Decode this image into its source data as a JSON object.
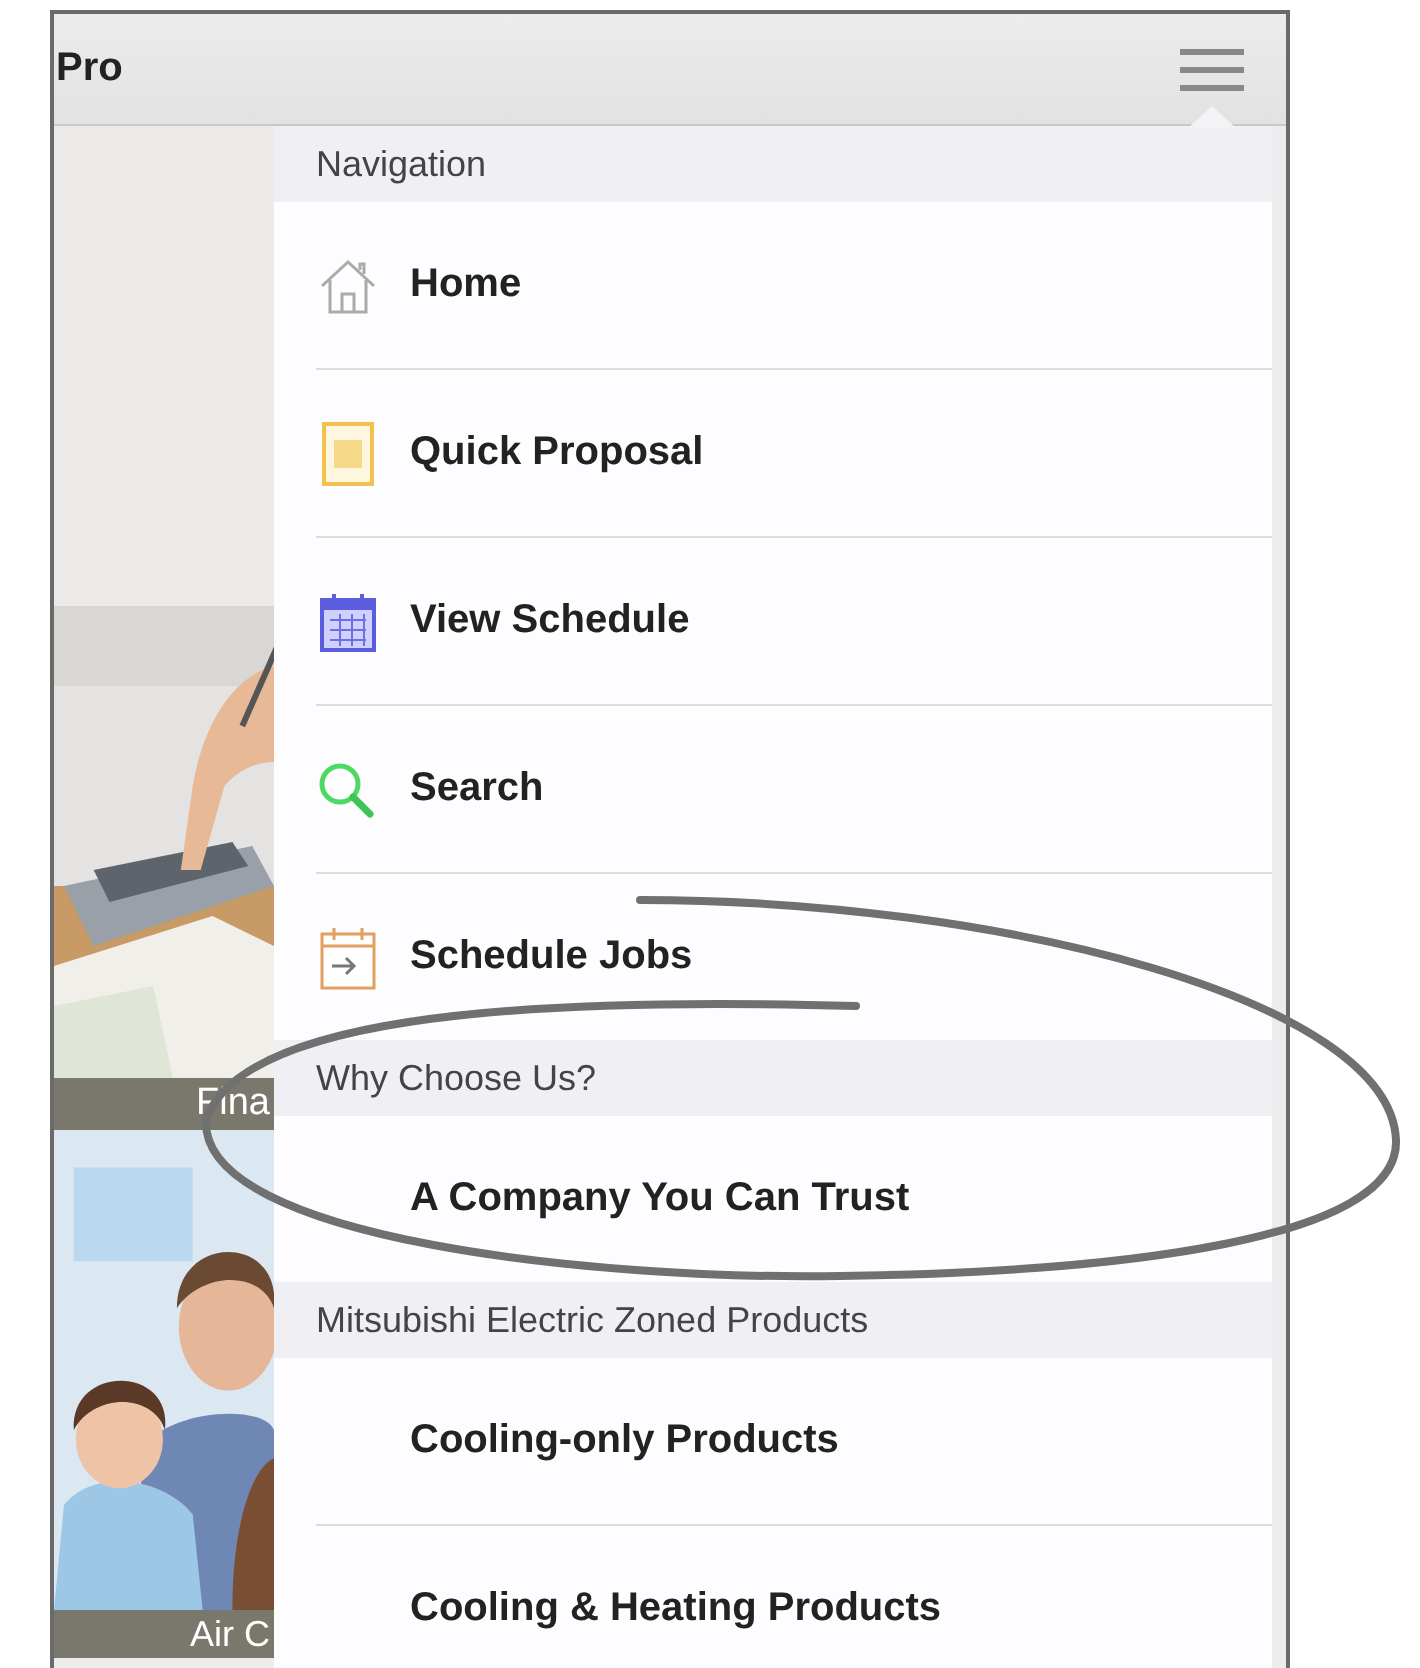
{
  "header": {
    "title": "Pro"
  },
  "tiles": [
    {
      "kind": "picture",
      "caption": "Fina"
    },
    {
      "kind": "picture",
      "caption": "Air C"
    }
  ],
  "menu": {
    "sections": [
      {
        "title": "Navigation",
        "items": [
          {
            "label": "Home"
          },
          {
            "label": "Quick Proposal"
          },
          {
            "label": "View Schedule"
          },
          {
            "label": "Search"
          },
          {
            "label": "Schedule Jobs"
          }
        ]
      },
      {
        "title": "Why Choose Us?",
        "items": [
          {
            "label": "A Company You Can Trust"
          }
        ]
      },
      {
        "title": "Mitsubishi Electric Zoned Products",
        "items": [
          {
            "label": "Cooling-only Products"
          },
          {
            "label": "Cooling & Heating Products"
          }
        ]
      }
    ]
  }
}
